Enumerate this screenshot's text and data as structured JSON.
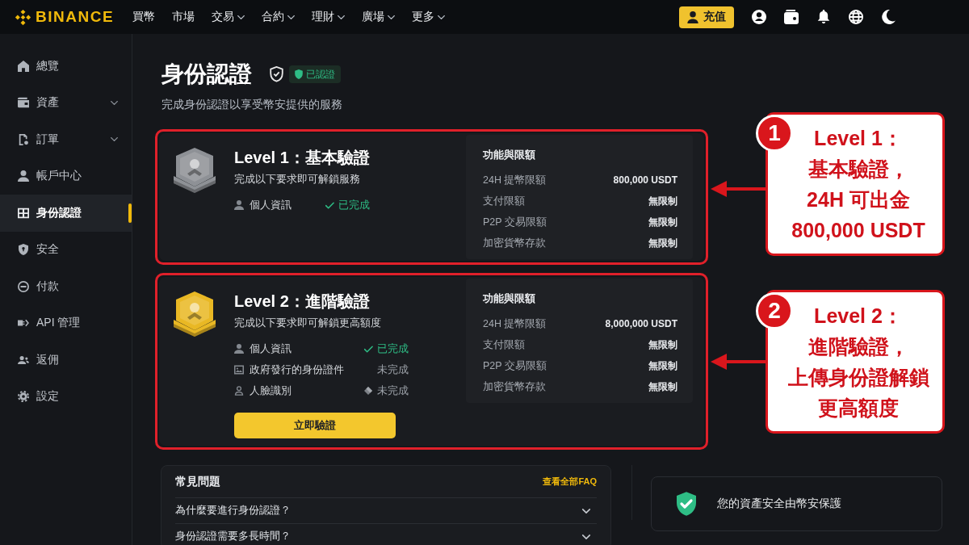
{
  "top_nav": {
    "logo": "BINANCE",
    "menu": [
      {
        "label": "買幣",
        "has_dropdown": false
      },
      {
        "label": "市場",
        "has_dropdown": false
      },
      {
        "label": "交易",
        "has_dropdown": true
      },
      {
        "label": "合約",
        "has_dropdown": true
      },
      {
        "label": "理財",
        "has_dropdown": true
      },
      {
        "label": "廣場",
        "has_dropdown": true
      },
      {
        "label": "更多",
        "has_dropdown": true
      }
    ],
    "deposit_button": "充值"
  },
  "sidebar": {
    "items": [
      {
        "label": "總覽",
        "has_submenu": false,
        "selected": false
      },
      {
        "label": "資產",
        "has_submenu": true,
        "selected": false
      },
      {
        "label": "訂單",
        "has_submenu": true,
        "selected": false
      },
      {
        "label": "帳戶中心",
        "has_submenu": false,
        "selected": false
      },
      {
        "label": "身份認證",
        "has_submenu": false,
        "selected": true
      },
      {
        "label": "安全",
        "has_submenu": false,
        "selected": false
      },
      {
        "label": "付款",
        "has_submenu": false,
        "selected": false
      },
      {
        "label": "API 管理",
        "has_submenu": false,
        "selected": false
      },
      {
        "label": "返佣",
        "has_submenu": false,
        "selected": false
      },
      {
        "label": "設定",
        "has_submenu": false,
        "selected": false
      }
    ]
  },
  "page": {
    "title": "身份認證",
    "verified_badge": "已認證",
    "subtitle": "完成身份認證以享受幣安提供的服務"
  },
  "levels": [
    {
      "title": "Level 1：基本驗證",
      "description": "完成以下要求即可解鎖服務",
      "color": "#8e9196",
      "highlighted": true,
      "requirements": [
        {
          "label": "個人資訊",
          "status": "已完成",
          "done": true,
          "marked": false
        }
      ],
      "limits_title": "功能與限額",
      "limits": [
        {
          "label": "24H 提幣限額",
          "value": "800,000 USDT"
        },
        {
          "label": "支付限額",
          "value": "無限制"
        },
        {
          "label": "P2P 交易限額",
          "value": "無限制"
        },
        {
          "label": "加密貨幣存款",
          "value": "無限制"
        }
      ]
    },
    {
      "title": "Level 2：進階驗證",
      "description": "完成以下要求即可解鎖更高額度",
      "color": "#e9b824",
      "highlighted": true,
      "requirements": [
        {
          "label": "個人資訊",
          "status": "已完成",
          "done": true,
          "marked": false
        },
        {
          "label": "政府發行的身份證件",
          "status": "未完成",
          "done": false,
          "marked": false
        },
        {
          "label": "人臉識別",
          "status": "未完成",
          "done": false,
          "marked": true
        }
      ],
      "limits_title": "功能與限額",
      "limits": [
        {
          "label": "24H 提幣限額",
          "value": "8,000,000 USDT"
        },
        {
          "label": "支付限額",
          "value": "無限制"
        },
        {
          "label": "P2P 交易限額",
          "value": "無限制"
        },
        {
          "label": "加密貨幣存款",
          "value": "無限制"
        }
      ],
      "action_button": "立即驗證"
    }
  ],
  "callouts": [
    {
      "number": "1",
      "lines": [
        "Level 1：",
        "基本驗證，",
        "24H 可出金",
        "800,000 USDT"
      ]
    },
    {
      "number": "2",
      "lines": [
        "Level 2：",
        "進階驗證，",
        "上傳身份證解鎖",
        "更高額度"
      ]
    }
  ],
  "faq": {
    "title": "常見問題",
    "view_all_link": "查看全部FAQ",
    "items": [
      {
        "question": "為什麼要進行身份認證？",
        "expanded": false
      },
      {
        "question": "身份認證需要多長時間？",
        "expanded": false
      }
    ]
  },
  "security_notice": "您的資產安全由幣安保護"
}
